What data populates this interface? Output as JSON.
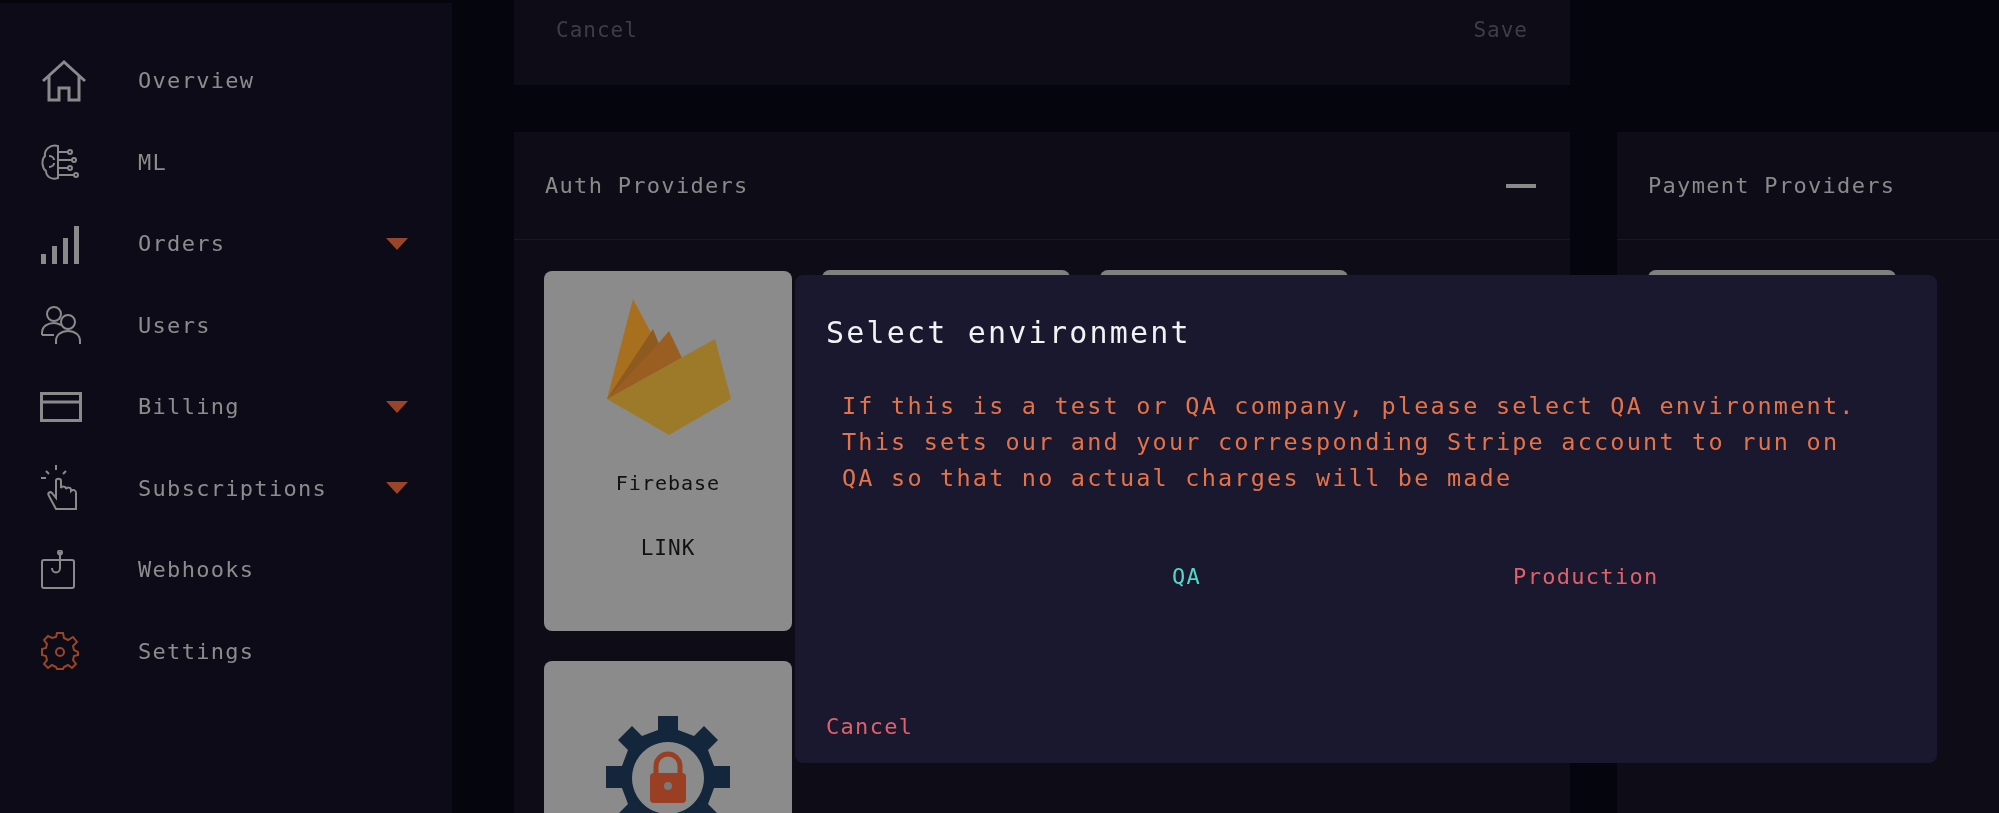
{
  "sidebar": {
    "items": [
      {
        "label": "Overview",
        "has_submenu": false,
        "selected": false
      },
      {
        "label": "ML",
        "has_submenu": false,
        "selected": false
      },
      {
        "label": "Orders",
        "has_submenu": true,
        "selected": false
      },
      {
        "label": "Users",
        "has_submenu": false,
        "selected": false
      },
      {
        "label": "Billing",
        "has_submenu": true,
        "selected": false
      },
      {
        "label": "Subscriptions",
        "has_submenu": true,
        "selected": false
      },
      {
        "label": "Webhooks",
        "has_submenu": false,
        "selected": false
      },
      {
        "label": "Settings",
        "has_submenu": false,
        "selected": true
      }
    ]
  },
  "top_panel": {
    "buttons": [
      "Cancel",
      "Save"
    ]
  },
  "auth_panel": {
    "title": "Auth Providers",
    "cards": [
      {
        "kind": "firebase",
        "name": "Firebase",
        "action": "LINK"
      },
      {
        "kind": "custom"
      }
    ]
  },
  "payment_panel": {
    "title": "Payment Providers"
  },
  "dialog": {
    "title": "Select environment",
    "message": "If this is a test or QA company, please select QA environment. This sets our and your corresponding Stripe account to run on QA so that no actual charges will be made",
    "options": [
      {
        "label": "QA",
        "color": "#4fd8c8"
      },
      {
        "label": "Production",
        "color": "#e0606c"
      }
    ],
    "cancel": "Cancel"
  }
}
